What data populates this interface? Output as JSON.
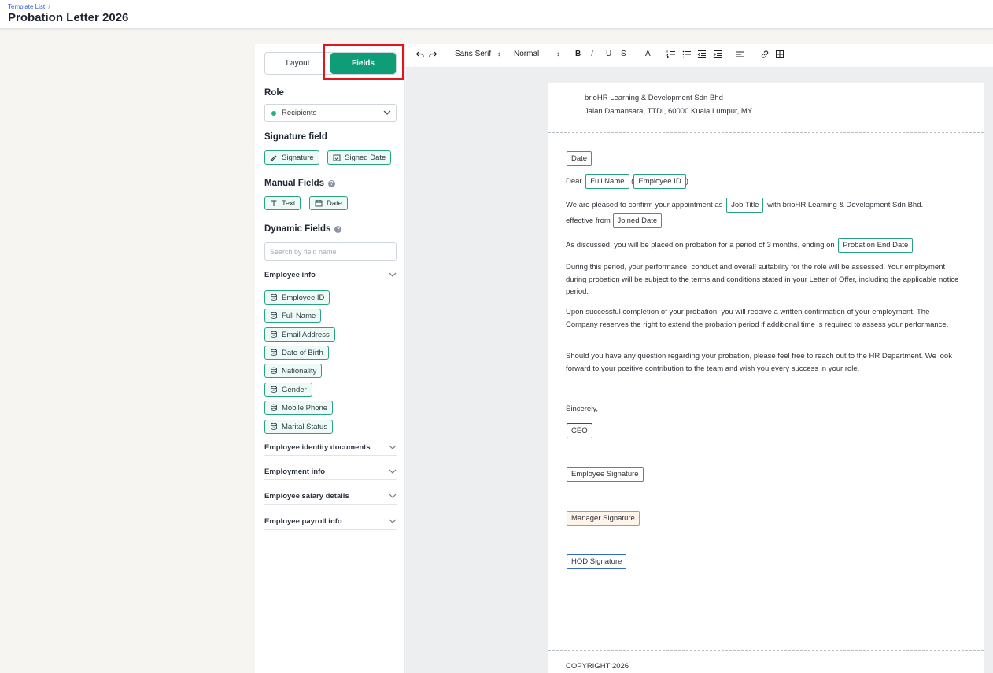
{
  "header": {
    "breadcrumb": "Template List",
    "breadcrumb_sep": "/",
    "title": "Probation Letter 2026"
  },
  "panel": {
    "tabs": {
      "layout": "Layout",
      "fields": "Fields"
    },
    "role_label": "Role",
    "role_value": "Recipients",
    "signature_field_label": "Signature field",
    "signature_chips": [
      "Signature",
      "Signed Date"
    ],
    "manual_fields_label": "Manual Fields",
    "manual_chips": [
      "Text",
      "Date"
    ],
    "dynamic_fields_label": "Dynamic Fields",
    "search_placeholder": "Search by field name",
    "employee_info_label": "Employee info",
    "employee_info_fields": [
      "Employee ID",
      "Full Name",
      "Email Address",
      "Date of Birth",
      "Nationality",
      "Gender",
      "Mobile Phone",
      "Marital Status"
    ],
    "sections": [
      "Employee identity documents",
      "Employment info",
      "Employee salary details",
      "Employee payroll info"
    ]
  },
  "toolbar": {
    "font": "Sans Serif",
    "size": "Normal",
    "bold": "B",
    "italic": "I",
    "underline": "U",
    "strike": "S",
    "color": "A"
  },
  "document": {
    "company": "brioHR Learning & Development Sdn Bhd",
    "address": "Jalan Damansara, TTDI, 60000 Kuala Lumpur, MY",
    "tokens": {
      "date": "Date",
      "full_name": "Full Name",
      "employee_id": "Employee ID",
      "job_title": "Job Title",
      "joined_date": "Joined Date",
      "probation_end": "Probation End Date",
      "ceo": "CEO",
      "employee_sig": "Employee Signature",
      "manager_sig": "Manager Signature",
      "hod_sig": "HOD Signature"
    },
    "dear": "Dear",
    "open_paren": "(",
    "close_paren": ").",
    "p1_a": "We are pleased to confirm your appointment as",
    "p1_b": "with brioHR Learning & Development Sdn Bhd.",
    "p1_c": "effective from",
    "p1_end": ".",
    "p2": "As discussed, you will be placed on probation for a period of 3 months, ending on",
    "p2_end": ".",
    "p3": "During this period, your performance, conduct and overall suitability for the role will be assessed. Your employment during probation will be subject to the terms and conditions stated in your Letter of Offer, including the applicable notice period.",
    "p4": "Upon successful completion of your probation, you will receive a written confirmation of your employment. The Company reserves the right to extend the probation period if additional time is required to assess your performance.",
    "p5": "Should you have any question regarding your probation, please feel free to reach out to the HR Department. We look forward to your positive contribution to the team and wish you every success in your role.",
    "sincerely": "Sincerely,",
    "footer": "COPYRIGHT 2026"
  }
}
